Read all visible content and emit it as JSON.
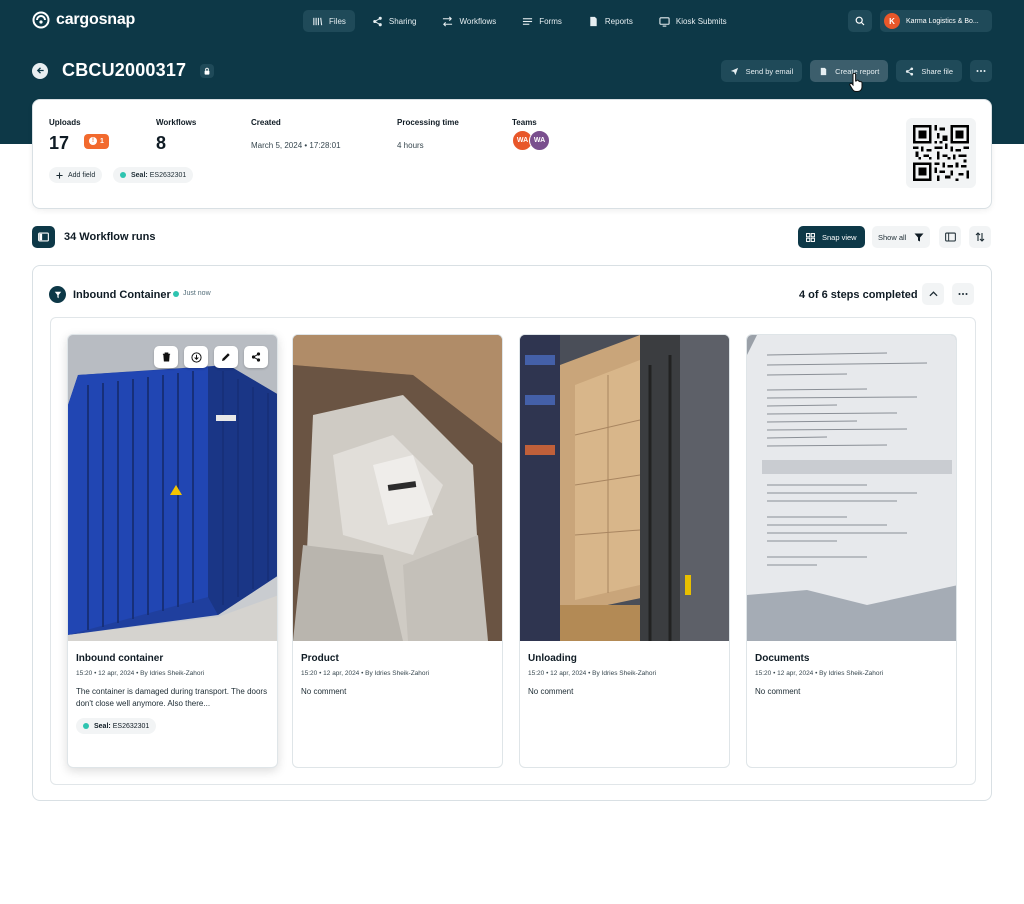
{
  "brand": {
    "name": "cargosnap"
  },
  "nav": [
    {
      "label": "Files",
      "icon": "files-icon",
      "active": true
    },
    {
      "label": "Sharing",
      "icon": "share-icon"
    },
    {
      "label": "Workflows",
      "icon": "workflow-icon"
    },
    {
      "label": "Forms",
      "icon": "forms-icon"
    },
    {
      "label": "Reports",
      "icon": "report-icon"
    },
    {
      "label": "Kiosk Submits",
      "icon": "monitor-icon"
    }
  ],
  "org": {
    "initial": "K",
    "name": "Karma Logistics & Bo..."
  },
  "file": {
    "title": "CBCU2000317"
  },
  "actions": {
    "email": "Send by email",
    "report": "Create report",
    "share": "Share file"
  },
  "summary": {
    "uploads_label": "Uploads",
    "uploads_value": "17",
    "alert_count": "1",
    "workflows_label": "Workflows",
    "workflows_value": "8",
    "created_label": "Created",
    "created_value": "March 5, 2024 • 17:28:01",
    "processing_label": "Processing time",
    "processing_value": "4 hours",
    "teams_label": "Teams",
    "teams": [
      "WA",
      "WA"
    ],
    "add_field": "Add field",
    "seal_label": "Seal:",
    "seal_value": "ES2632301"
  },
  "runs": {
    "title": "34 Workflow runs",
    "snap_view": "Snap view",
    "show_all": "Show all"
  },
  "workflow": {
    "title": "Inbound Container",
    "time": "Just now",
    "steps": "4 of 6 steps completed",
    "cards": [
      {
        "title": "Inbound container",
        "meta": "15:20 • 12 apr, 2024 • By Idries Sheik-Zahori",
        "comment": "The container is damaged during transport. The doors don't close well anymore. Also there...",
        "seal_label": "Seal:",
        "seal_value": "ES2632301"
      },
      {
        "title": "Product",
        "meta": "15:20 • 12 apr, 2024 • By Idries Sheik-Zahori",
        "comment": "No comment"
      },
      {
        "title": "Unloading",
        "meta": "15:20 • 12 apr, 2024 • By Idries Sheik-Zahori",
        "comment": "No comment"
      },
      {
        "title": "Documents",
        "meta": "15:20 • 12 apr, 2024 • By Idries Sheik-Zahori",
        "comment": "No comment"
      }
    ]
  },
  "colors": {
    "header": "#0d3847",
    "accent_orange": "#f26a2e",
    "teal": "#2ec4b0",
    "team_orange": "#e8572a",
    "team_purple": "#7a4f8e"
  }
}
